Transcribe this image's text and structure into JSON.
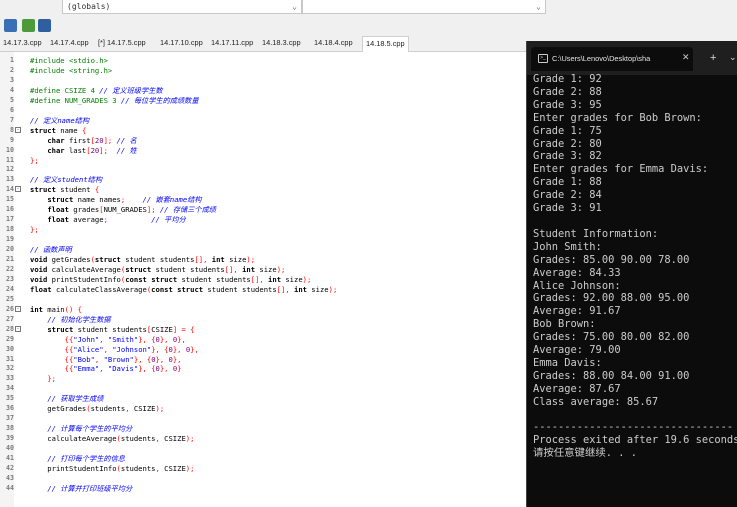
{
  "toolbar": {
    "scope_select": "(globals)",
    "second_select": ""
  },
  "tabs": [
    {
      "label": "14.17.3.cpp"
    },
    {
      "label": "14.17.4.cpp"
    },
    {
      "label": "[*] 14.17.5.cpp"
    },
    {
      "label": "14.17.10.cpp"
    },
    {
      "label": "14.17.11.cpp"
    },
    {
      "label": "14.18.3.cpp"
    },
    {
      "label": "14.18.4.cpp"
    },
    {
      "label": "14.18.5.cpp"
    }
  ],
  "code_lines": [
    {
      "n": "1",
      "t": "#include <stdio.h>"
    },
    {
      "n": "2",
      "t": "#include <string.h>"
    },
    {
      "n": "3",
      "t": ""
    },
    {
      "n": "4",
      "t": "#define CSIZE 4 // 定义班级学生数"
    },
    {
      "n": "5",
      "t": "#define NUM_GRADES 3 // 每位学生的成绩数量"
    },
    {
      "n": "6",
      "t": ""
    },
    {
      "n": "7",
      "t": "// 定义name结构"
    },
    {
      "n": "8",
      "t": "struct name {"
    },
    {
      "n": "9",
      "t": "    char first[20]; // 名"
    },
    {
      "n": "10",
      "t": "    char last[20];  // 姓"
    },
    {
      "n": "11",
      "t": "};"
    },
    {
      "n": "12",
      "t": ""
    },
    {
      "n": "13",
      "t": "// 定义student结构"
    },
    {
      "n": "14",
      "t": "struct student {"
    },
    {
      "n": "15",
      "t": "    struct name names;    // 嵌套name结构"
    },
    {
      "n": "16",
      "t": "    float grades[NUM_GRADES]; // 存储三个成绩"
    },
    {
      "n": "17",
      "t": "    float average;          // 平均分"
    },
    {
      "n": "18",
      "t": "};"
    },
    {
      "n": "19",
      "t": ""
    },
    {
      "n": "20",
      "t": "// 函数声明"
    },
    {
      "n": "21",
      "t": "void getGrades(struct student students[], int size);"
    },
    {
      "n": "22",
      "t": "void calculateAverage(struct student students[], int size);"
    },
    {
      "n": "23",
      "t": "void printStudentInfo(const struct student students[], int size);"
    },
    {
      "n": "24",
      "t": "float calculateClassAverage(const struct student students[], int size);"
    },
    {
      "n": "25",
      "t": ""
    },
    {
      "n": "26",
      "t": "int main() {"
    },
    {
      "n": "27",
      "t": "    // 初始化学生数据"
    },
    {
      "n": "28",
      "t": "    struct student students[CSIZE] = {"
    },
    {
      "n": "29",
      "t": "        {{\"John\", \"Smith\"}, {0}, 0},"
    },
    {
      "n": "30",
      "t": "        {{\"Alice\", \"Johnson\"}, {0}, 0},"
    },
    {
      "n": "31",
      "t": "        {{\"Bob\", \"Brown\"}, {0}, 0},"
    },
    {
      "n": "32",
      "t": "        {{\"Emma\", \"Davis\"}, {0}, 0}"
    },
    {
      "n": "33",
      "t": "    };"
    },
    {
      "n": "34",
      "t": ""
    },
    {
      "n": "35",
      "t": "    // 获取学生成绩"
    },
    {
      "n": "36",
      "t": "    getGrades(students, CSIZE);"
    },
    {
      "n": "37",
      "t": ""
    },
    {
      "n": "38",
      "t": "    // 计算每个学生的平均分"
    },
    {
      "n": "39",
      "t": "    calculateAverage(students, CSIZE);"
    },
    {
      "n": "40",
      "t": ""
    },
    {
      "n": "41",
      "t": "    // 打印每个学生的信息"
    },
    {
      "n": "42",
      "t": "    printStudentInfo(students, CSIZE);"
    },
    {
      "n": "43",
      "t": ""
    },
    {
      "n": "44",
      "t": "    // 计算并打印班级平均分"
    }
  ],
  "console": {
    "title": "C:\\Users\\Lenovo\\Desktop\\sha",
    "lines": [
      "Grade 1: 92",
      "Grade 2: 88",
      "Grade 3: 95",
      "Enter grades for Bob Brown:",
      "Grade 1: 75",
      "Grade 2: 80",
      "Grade 3: 82",
      "Enter grades for Emma Davis:",
      "Grade 1: 88",
      "Grade 2: 84",
      "Grade 3: 91",
      "",
      "Student Information:",
      "John Smith:",
      "Grades: 85.00 90.00 78.00",
      "Average: 84.33",
      "Alice Johnson:",
      "Grades: 92.00 88.00 95.00",
      "Average: 91.67",
      "Bob Brown:",
      "Grades: 75.00 80.00 82.00",
      "Average: 79.00",
      "Emma Davis:",
      "Grades: 88.00 84.00 91.00",
      "Average: 87.67",
      "Class average: 85.67",
      "",
      "--------------------------------",
      "Process exited after 19.6 seconds",
      "请按任意键继续. . ."
    ]
  }
}
